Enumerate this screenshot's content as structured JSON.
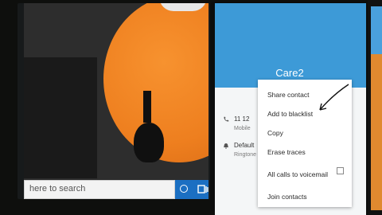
{
  "desktop": {
    "search_placeholder": "here to search"
  },
  "phone": {
    "contact_name": "Care2",
    "details": [
      {
        "icon": "phone-icon",
        "value": "11 12",
        "label": "Mobile"
      },
      {
        "icon": "ringtone-icon",
        "value": "Default",
        "label": "Ringtone"
      }
    ],
    "menu": {
      "items": [
        "Share contact",
        "Add to blacklist",
        "Copy",
        "Erase traces",
        "All calls to voicemail",
        "Join contacts"
      ],
      "voicemail_checked": false
    }
  },
  "colors": {
    "header_blue": "#3d9ad7",
    "taskbar_blue": "#1b6fc2",
    "orange": "#ee7f1f"
  }
}
